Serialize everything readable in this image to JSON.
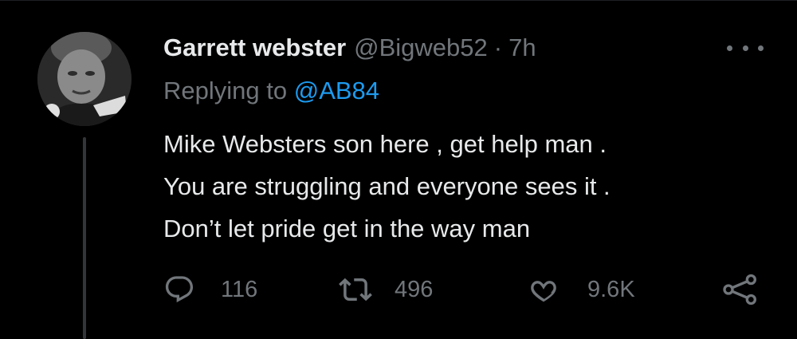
{
  "tweet": {
    "display_name": "Garrett webster",
    "handle": "@Bigweb52",
    "separator": "·",
    "time": "7h",
    "replying_prefix": "Replying to",
    "replying_to": "@AB84",
    "body_lines": [
      "Mike Websters son here , get help man .",
      "You are struggling and everyone sees it .",
      "Don’t let pride get in the way man"
    ]
  },
  "actions": {
    "reply": {
      "icon": "reply-icon",
      "count": "116"
    },
    "retweet": {
      "icon": "retweet-icon",
      "count": "496"
    },
    "like": {
      "icon": "heart-icon",
      "count": "9.6K"
    },
    "share": {
      "icon": "share-icon"
    }
  },
  "more_menu": {
    "icon": "more-horizontal-icon"
  },
  "colors": {
    "background": "#000000",
    "primary_text": "#e7e9ea",
    "secondary_text": "#71767b",
    "accent": "#1d9bf0",
    "thread_line": "#333639"
  }
}
